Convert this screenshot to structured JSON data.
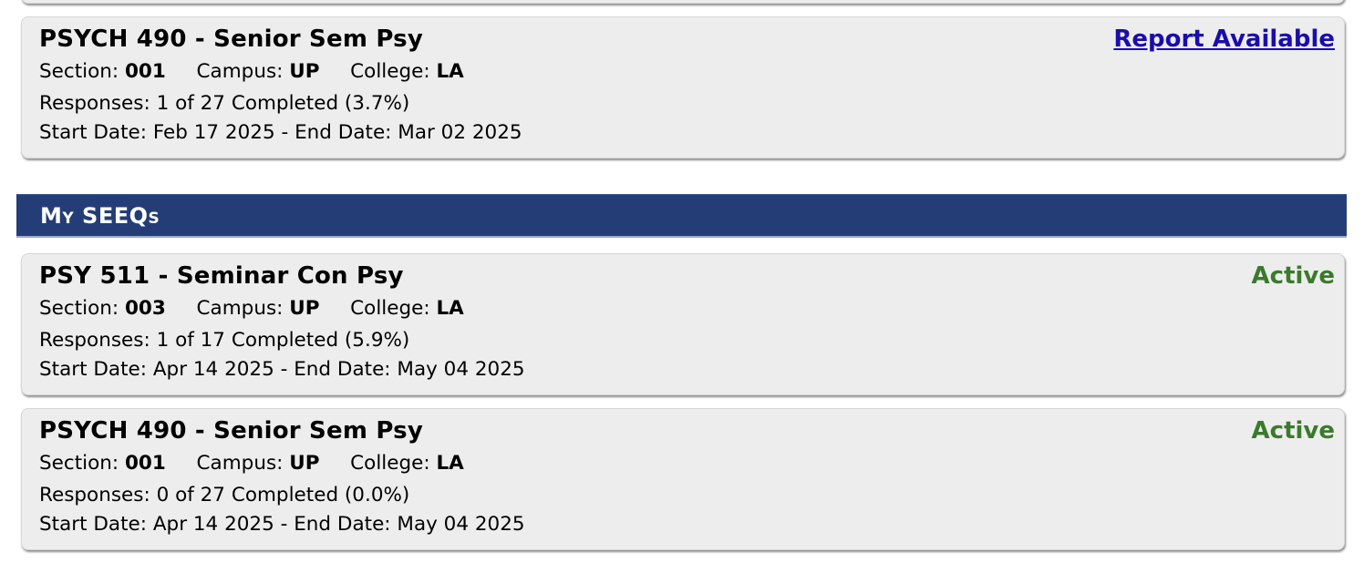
{
  "labels": {
    "section": "Section:",
    "campus": "Campus:",
    "college": "College:",
    "responses": "Responses:",
    "start_date": "Start Date:",
    "end_date_sep": "- End Date:"
  },
  "top_card": {
    "title": "PSYCH 490 - Senior Sem Psy",
    "status": "Report Available",
    "section": "001",
    "campus": "UP",
    "college": "LA",
    "responses": "1 of 27 Completed (3.7%)",
    "start_date": "Feb 17 2025",
    "end_date": "Mar 02 2025"
  },
  "my_seeqs": {
    "header": "My SEEQs",
    "items": [
      {
        "title": "PSY 511 - Seminar Con Psy",
        "status": "Active",
        "section": "003",
        "campus": "UP",
        "college": "LA",
        "responses": "1 of 17 Completed (5.9%)",
        "start_date": "Apr 14 2025",
        "end_date": "May 04 2025"
      },
      {
        "title": "PSYCH 490 - Senior Sem Psy",
        "status": "Active",
        "section": "001",
        "campus": "UP",
        "college": "LA",
        "responses": "0 of 27 Completed (0.0%)",
        "start_date": "Apr 14 2025",
        "end_date": "May 04 2025"
      }
    ]
  },
  "colors": {
    "header_bg": "#253d77",
    "active": "#3a7a2c",
    "link": "#1a0dab",
    "card_bg": "#ededed"
  }
}
